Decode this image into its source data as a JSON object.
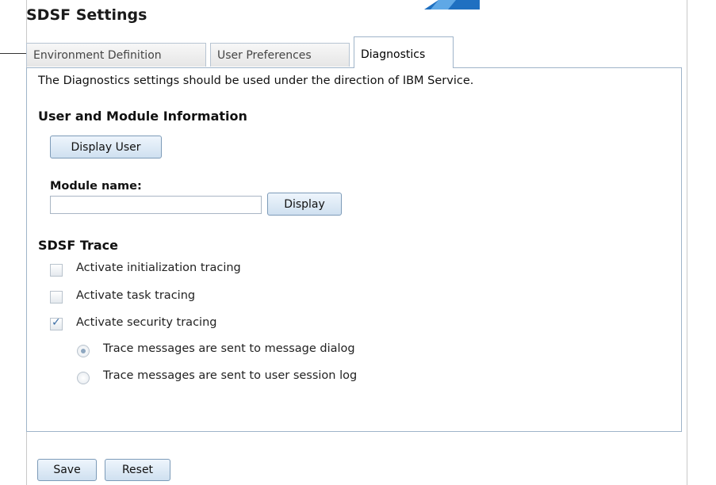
{
  "dialog": {
    "title": "SDSF Settings"
  },
  "tabs": [
    {
      "label": "Environment Definition",
      "active": false
    },
    {
      "label": "User Preferences",
      "active": false
    },
    {
      "label": "Diagnostics",
      "active": true
    }
  ],
  "diagnostics": {
    "note": "The Diagnostics settings should be used under the direction of IBM Service.",
    "user_module": {
      "heading": "User and Module Information",
      "display_user_label": "Display User",
      "module_name_label": "Module name:",
      "module_name_value": "",
      "display_label": "Display"
    },
    "trace": {
      "heading": "SDSF Trace",
      "options": [
        {
          "label": "Activate initialization tracing",
          "checked": false
        },
        {
          "label": "Activate task tracing",
          "checked": false
        },
        {
          "label": "Activate security tracing",
          "checked": true
        }
      ],
      "destinations": [
        {
          "label": "Trace messages are sent to message dialog",
          "selected": true
        },
        {
          "label": "Trace messages are sent to user session log",
          "selected": false
        }
      ]
    }
  },
  "footer": {
    "save_label": "Save",
    "reset_label": "Reset"
  },
  "colors": {
    "accent_blue": "#1f70c1",
    "tab_border": "#9fb4c9",
    "button_fill": "#cfe0f0"
  }
}
